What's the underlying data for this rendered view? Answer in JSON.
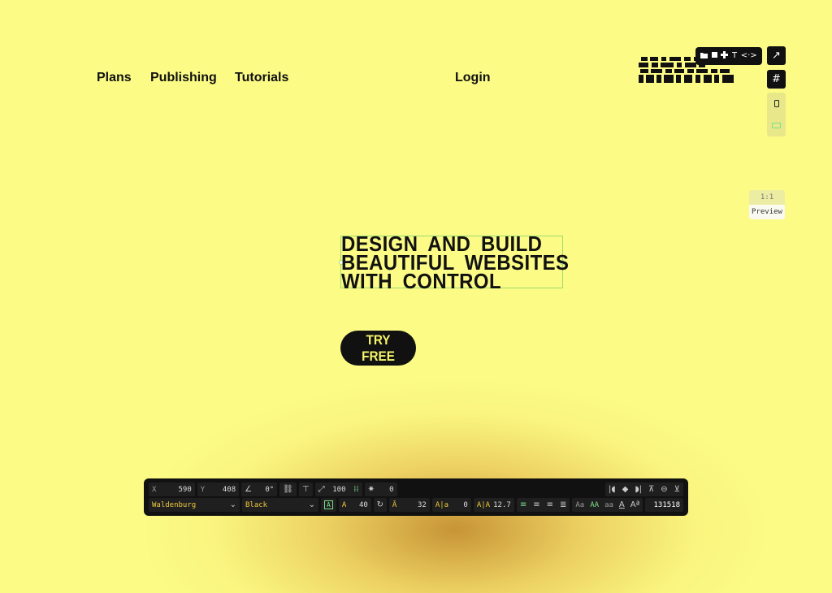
{
  "nav": {
    "plans": "Plans",
    "publishing": "Publishing",
    "tutorials": "Tutorials",
    "login": "Login"
  },
  "element_toolbar": {
    "icons": [
      "folder-icon",
      "square-icon",
      "component-icon",
      "text-icon",
      "code-icon"
    ],
    "text_glyph": "T",
    "code_glyph": "<·>"
  },
  "side_buttons": {
    "open_glyph": "↗",
    "grid_glyph": "#"
  },
  "scale": {
    "ratio": "1:1",
    "preview": "Preview"
  },
  "hero": {
    "headline_lines": [
      "DESIGN AND BUILD",
      "BEAUTIFUL WEBSITES",
      "WITH CONTROL"
    ],
    "cta": "TRY FREE"
  },
  "properties": {
    "x_label": "X",
    "x_value": "590",
    "y_label": "Y",
    "y_value": "408",
    "rotation": "0°",
    "scale_value": "100",
    "blur_value": "0",
    "font_family": "Waldenburg",
    "font_weight": "Black",
    "font_size": "40",
    "line_height": "32",
    "letter_spacing": "0",
    "word_spacing": "12.7",
    "case_options": [
      "Aa",
      "AA",
      "aa"
    ],
    "color_hex": "131518"
  },
  "colors": {
    "background": "#fbfb85",
    "accent_text": "#f7f56a",
    "selection": "#9ddc6e",
    "panel": "#111111"
  }
}
